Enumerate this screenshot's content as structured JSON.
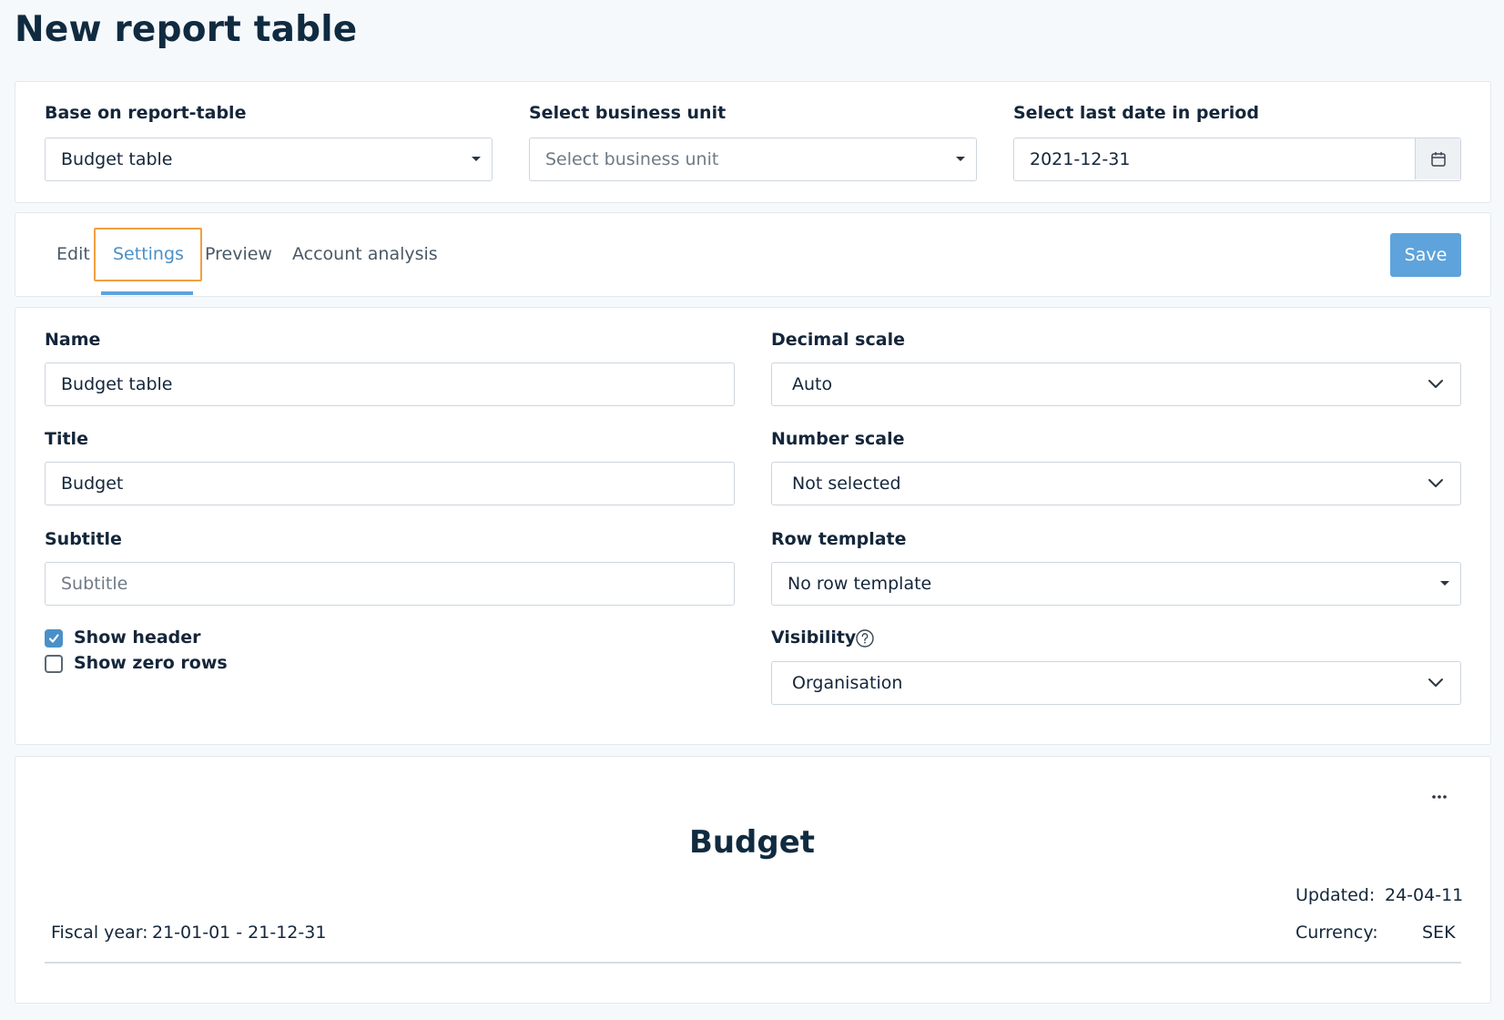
{
  "page": {
    "title": "New report table"
  },
  "filters": {
    "base_label": "Base on report-table",
    "base_value": "Budget table",
    "bu_label": "Select business unit",
    "bu_placeholder": "Select business unit",
    "date_label": "Select last date in period",
    "date_value": "2021-12-31"
  },
  "tabs": [
    {
      "label": "Edit"
    },
    {
      "label": "Settings",
      "active": true
    },
    {
      "label": "Preview"
    },
    {
      "label": "Account analysis"
    }
  ],
  "toolbar": {
    "save_label": "Save"
  },
  "settings": {
    "name_label": "Name",
    "name_value": "Budget table",
    "title_label": "Title",
    "title_value": "Budget",
    "subtitle_label": "Subtitle",
    "subtitle_placeholder": "Subtitle",
    "show_header_label": "Show header",
    "show_header_checked": true,
    "show_zero_rows_label": "Show zero rows",
    "show_zero_rows_checked": false,
    "decimal_scale_label": "Decimal scale",
    "decimal_scale_value": "Auto",
    "number_scale_label": "Number scale",
    "number_scale_value": "Not selected",
    "row_template_label": "Row template",
    "row_template_value": "No row template",
    "visibility_label": "Visibility",
    "visibility_value": "Organisation"
  },
  "preview": {
    "more_label": "···",
    "title": "Budget",
    "updated_label": "Updated:",
    "updated_value": "24-04-11",
    "fiscal_label": "Fiscal year:",
    "fiscal_value": "21-01-01 - 21-12-31",
    "currency_label": "Currency:",
    "currency_value": "SEK"
  },
  "colors": {
    "accent": "#4a90c8",
    "save_bg": "#5ea3db",
    "highlight": "#f0a040"
  },
  "icons": {
    "calendar": "calendar-icon",
    "help": "help-circle-icon",
    "check": "check-icon",
    "more": "more-icon"
  }
}
